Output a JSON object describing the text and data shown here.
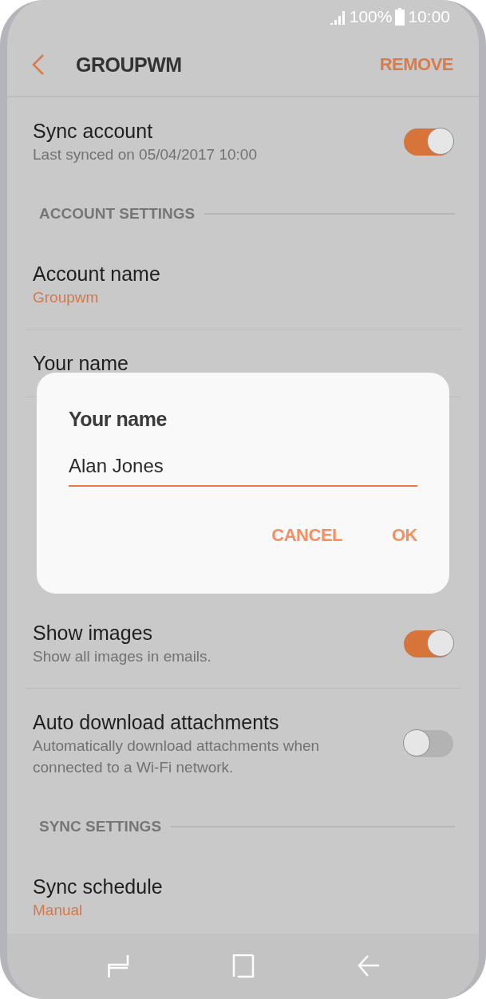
{
  "status_bar": {
    "battery": "100%",
    "time": "10:00"
  },
  "app_bar": {
    "title": "GROUPWM",
    "action": "REMOVE"
  },
  "items_above": [
    {
      "kind": "toggle",
      "title": "Sync account",
      "subtitle": [
        "Last synced on 05/04/2017  10:00"
      ],
      "color": "#727272",
      "on": true
    },
    {
      "kind": "header",
      "title": "ACCOUNT SETTINGS"
    },
    {
      "kind": "text",
      "title": "Account name",
      "subtitle": [
        "Groupwm"
      ],
      "color": "#d4784b"
    },
    {
      "kind": "text",
      "title": "Your name"
    }
  ],
  "items_below": [
    {
      "kind": "toggle",
      "title": "Show images",
      "subtitle": [
        "Show all images in emails."
      ],
      "color": "#727272",
      "on": true
    },
    {
      "kind": "toggle",
      "title": "Auto download attachments",
      "subtitle": [
        "Automatically download attachments when",
        "connected to a Wi-Fi network."
      ],
      "color": "#727272",
      "on": false
    },
    {
      "kind": "header",
      "title": "SYNC SETTINGS"
    },
    {
      "kind": "text",
      "title": "Sync schedule",
      "subtitle": [
        "Manual"
      ],
      "color": "#d4784b"
    }
  ],
  "dialog": {
    "title": "Your name",
    "value": "Alan Jones",
    "buttons": [
      "CANCEL",
      "OK"
    ]
  }
}
